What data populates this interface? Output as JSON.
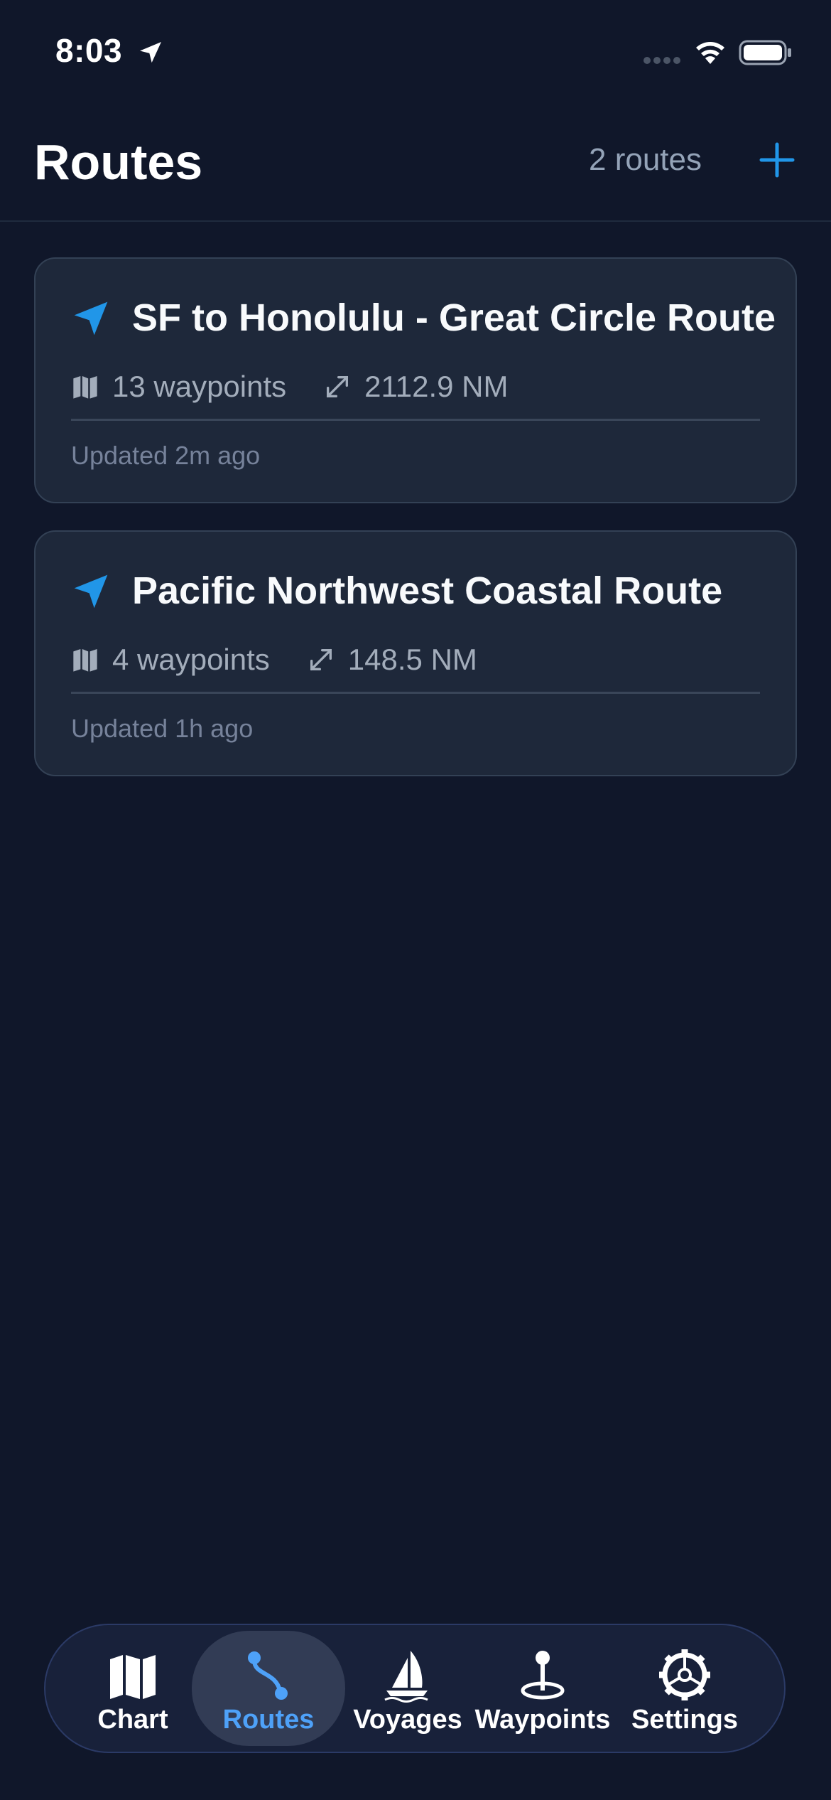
{
  "status_bar": {
    "time": "8:03"
  },
  "header": {
    "title": "Routes",
    "route_count": "2 routes",
    "add_icon": "plus-icon"
  },
  "routes": [
    {
      "name": "SF to Honolulu - Great Circle Route",
      "waypoints": "13 waypoints",
      "distance": "2112.9 NM",
      "updated": "Updated 2m ago"
    },
    {
      "name": "Pacific Northwest Coastal Route",
      "waypoints": "4 waypoints",
      "distance": "148.5 NM",
      "updated": "Updated 1h ago"
    }
  ],
  "tab_bar": {
    "tabs": [
      {
        "label": "Chart",
        "icon": "map-icon",
        "active": false
      },
      {
        "label": "Routes",
        "icon": "route-icon",
        "active": true
      },
      {
        "label": "Voyages",
        "icon": "sailboat-icon",
        "active": false
      },
      {
        "label": "Waypoints",
        "icon": "pin-icon",
        "active": false
      },
      {
        "label": "Settings",
        "icon": "gear-icon",
        "active": false
      }
    ]
  },
  "colors": {
    "background": "#10172a",
    "card": "#1e283a",
    "accent": "#2196e8",
    "active_tab": "#4ea1f8"
  }
}
